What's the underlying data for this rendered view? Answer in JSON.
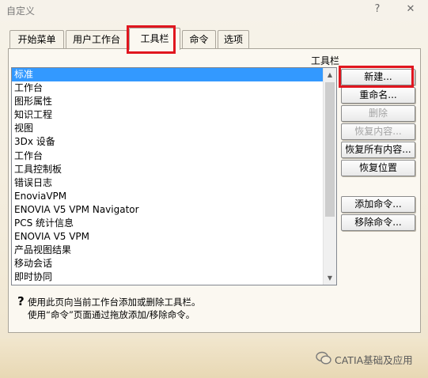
{
  "window": {
    "title": "自定义",
    "help_glyph": "?",
    "close_glyph": "✕"
  },
  "tabs": [
    {
      "label": "开始菜单"
    },
    {
      "label": "用户工作台"
    },
    {
      "label": "工具栏",
      "active": true
    },
    {
      "label": "命令"
    },
    {
      "label": "选项"
    }
  ],
  "toolbar_section": {
    "label": "工具栏",
    "items": [
      "标准",
      "工作台",
      "图形属性",
      "知识工程",
      "视图",
      "3Dx 设备",
      "工作台",
      "工具控制板",
      "错误日志",
      "EnoviaVPM",
      "ENOVIA V5 VPM Navigator",
      "PCS 统计信息",
      "ENOVIA V5 VPM",
      "产品视图结果",
      "移动会话",
      "即时协同"
    ],
    "selected_index": 0
  },
  "buttons": {
    "new": "新建...",
    "rename": "重命名...",
    "delete": "删除",
    "restore_content": "恢复内容...",
    "restore_all": "恢复所有内容...",
    "restore_position": "恢复位置",
    "add_command": "添加命令...",
    "remove_command": "移除命令..."
  },
  "hint": {
    "line1": "使用此页向当前工作台添加或删除工具栏。",
    "line2": "使用“命令”页面通过拖放添加/移除命令。"
  },
  "watermark": {
    "text": "CATIA基础及应用"
  },
  "colors": {
    "selection": "#3399ff",
    "highlight_box": "#e0161f"
  }
}
